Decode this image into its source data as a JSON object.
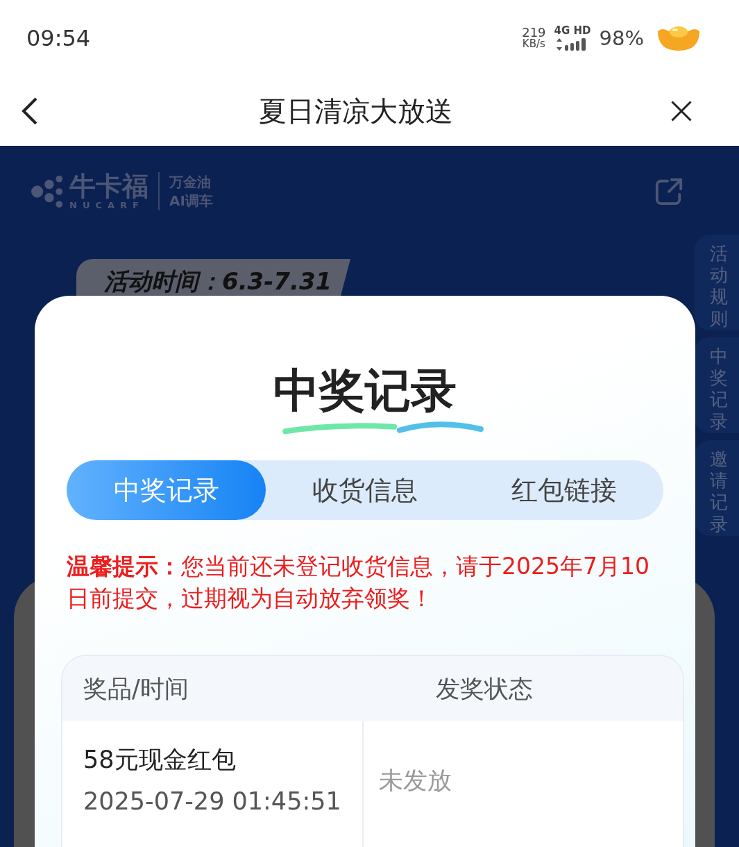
{
  "status_bar": {
    "time": "09:54",
    "speed": "219",
    "speed_unit": "KB/s",
    "network": "4G HD",
    "battery": "98%"
  },
  "nav": {
    "title": "夏日清凉大放送"
  },
  "background": {
    "brand": "牛卡福",
    "brand_en": "NUCARF",
    "partner": [
      "万金油",
      "AI调车"
    ],
    "activity_time": "活动时间：6.3-7.31",
    "side_tabs": [
      "活动规则",
      "中奖记录",
      "邀请记录"
    ]
  },
  "modal": {
    "title": "中奖记录",
    "tabs": [
      {
        "label": "中奖记录",
        "selected": true
      },
      {
        "label": "收货信息",
        "selected": false
      },
      {
        "label": "红包链接",
        "selected": false
      }
    ],
    "notice": "**温馨提示：**您当前还未登记收货信息，请于2025年7月10日前提交，过期视为自动放弃领奖！",
    "table": {
      "columns": [
        "奖品/时间",
        "发奖状态"
      ],
      "rows": [
        {
          "prize": "58元现金红包",
          "time": "2025-07-29 01:45:51",
          "status": "未发放"
        }
      ]
    }
  }
}
